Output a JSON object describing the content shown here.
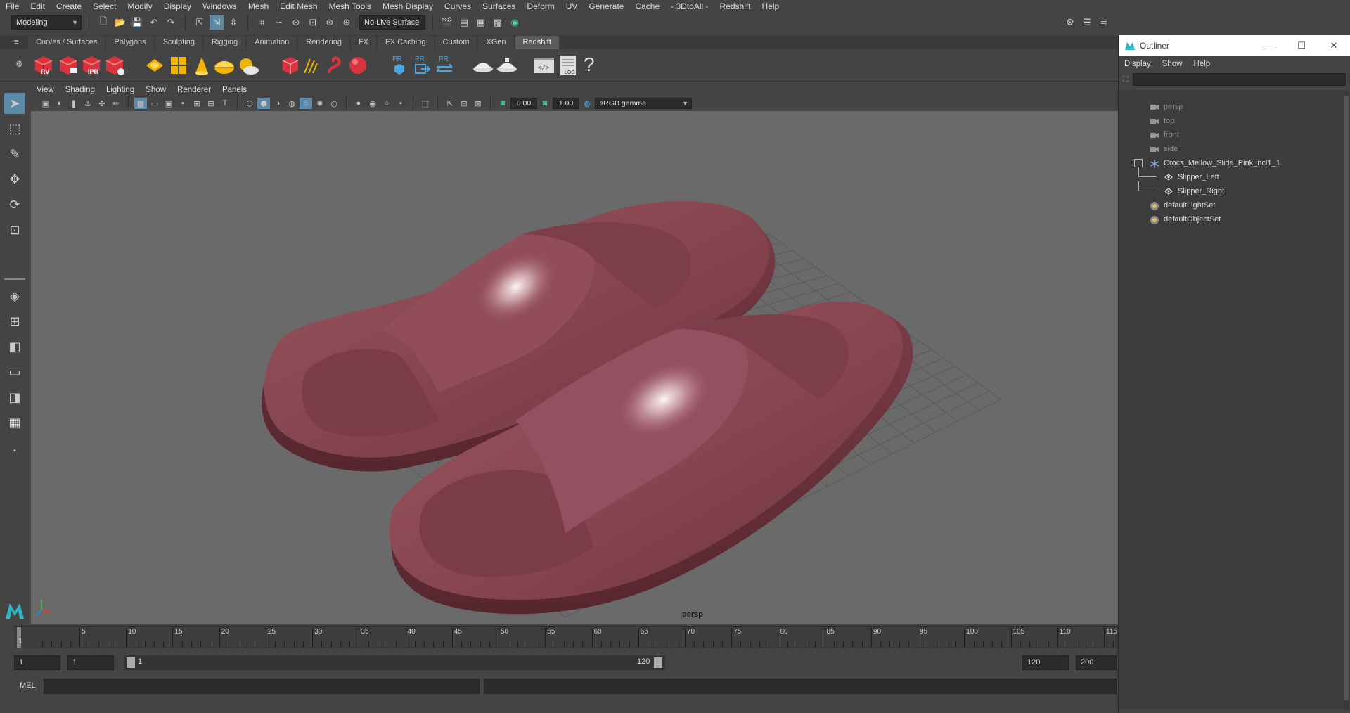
{
  "menubar": {
    "items": [
      "File",
      "Edit",
      "Create",
      "Select",
      "Modify",
      "Display",
      "Windows",
      "Mesh",
      "Edit Mesh",
      "Mesh Tools",
      "Mesh Display",
      "Curves",
      "Surfaces",
      "Deform",
      "UV",
      "Generate",
      "Cache",
      "- 3DtoAll -",
      "Redshift",
      "Help"
    ]
  },
  "statusline": {
    "workspace": "Modeling",
    "live_surface": "No Live Surface"
  },
  "shelf_tabs": [
    {
      "label": "Curves / Surfaces",
      "active": false
    },
    {
      "label": "Polygons",
      "active": false
    },
    {
      "label": "Sculpting",
      "active": false
    },
    {
      "label": "Rigging",
      "active": false
    },
    {
      "label": "Animation",
      "active": false
    },
    {
      "label": "Rendering",
      "active": false
    },
    {
      "label": "FX",
      "active": false
    },
    {
      "label": "FX Caching",
      "active": false
    },
    {
      "label": "Custom",
      "active": false
    },
    {
      "label": "XGen",
      "active": false
    },
    {
      "label": "Redshift",
      "active": true
    }
  ],
  "shelf": {
    "rv_label": "RV",
    "ipr_label": "IPR",
    "pr_label": "PR",
    "log_label": "LOG",
    "help_glyph": "?"
  },
  "panel_menu": [
    "View",
    "Shading",
    "Lighting",
    "Show",
    "Renderer",
    "Panels"
  ],
  "panel_toolbar": {
    "exposure": "0.00",
    "gamma": "1.00",
    "colorspace": "sRGB gamma"
  },
  "viewport": {
    "camera_label": "persp",
    "object_color": "#8a4a56",
    "background": "#6a6a6a"
  },
  "timeline": {
    "ticks": [
      "5",
      "10",
      "15",
      "20",
      "25",
      "30",
      "35",
      "40",
      "45",
      "50",
      "55",
      "60",
      "65",
      "70",
      "75",
      "80",
      "85",
      "90",
      "95",
      "100",
      "105",
      "110",
      "115"
    ],
    "current_frame": "1"
  },
  "range": {
    "start": "1",
    "playback_start": "1",
    "slider_start": "1",
    "slider_end": "120",
    "playback_end": "120",
    "end": "200"
  },
  "command": {
    "label": "MEL"
  },
  "outliner": {
    "title": "Outliner",
    "menu": [
      "Display",
      "Show",
      "Help"
    ],
    "items": [
      {
        "label": "persp",
        "icon": "camera-icon",
        "level": 0,
        "dim": true
      },
      {
        "label": "top",
        "icon": "camera-icon",
        "level": 0,
        "dim": true
      },
      {
        "label": "front",
        "icon": "camera-icon",
        "level": 0,
        "dim": true
      },
      {
        "label": "side",
        "icon": "camera-icon",
        "level": 0,
        "dim": true
      },
      {
        "label": "Crocs_Mellow_Slide_Pink_ncl1_1",
        "icon": "group-icon",
        "level": 0,
        "dim": false,
        "expanded": true
      },
      {
        "label": "Slipper_Left",
        "icon": "mesh-icon",
        "level": 1,
        "dim": false
      },
      {
        "label": "Slipper_Right",
        "icon": "mesh-icon",
        "level": 1,
        "dim": false
      },
      {
        "label": "defaultLightSet",
        "icon": "set-icon",
        "level": 0,
        "dim": false
      },
      {
        "label": "defaultObjectSet",
        "icon": "set-icon",
        "level": 0,
        "dim": false
      }
    ]
  }
}
